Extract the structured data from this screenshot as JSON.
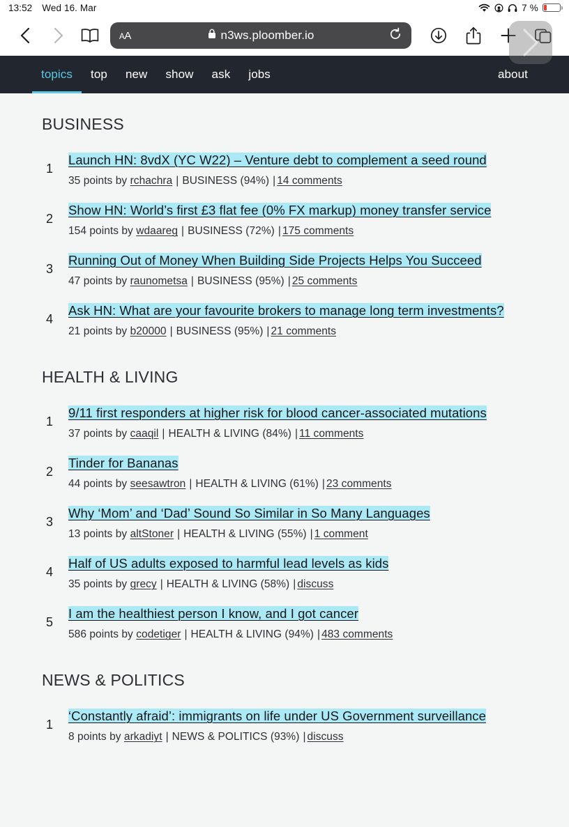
{
  "status_bar": {
    "time": "13:52",
    "date": "Wed 16. Mar",
    "battery_percent": "7 %",
    "icons": [
      "wifi-icon",
      "privacy-icon",
      "headphones-icon",
      "battery-icon"
    ]
  },
  "browser": {
    "back_label": "back-chevron",
    "forward_label": "forward-chevron",
    "bookmarks_label": "book-icon",
    "text_size_label": "AA",
    "url": "n3ws.ploomber.io",
    "reload_label": "reload-icon",
    "downloads_label": "downloads-icon",
    "share_label": "share-icon",
    "newtab_label": "plus-icon",
    "tabs_label": "tabs-icon"
  },
  "site_nav": {
    "items": [
      {
        "label": "topics",
        "active": true
      },
      {
        "label": "top",
        "active": false
      },
      {
        "label": "new",
        "active": false
      },
      {
        "label": "show",
        "active": false
      },
      {
        "label": "ask",
        "active": false
      },
      {
        "label": "jobs",
        "active": false
      }
    ],
    "about": "about",
    "accent_color": "#5bc8ea",
    "background_color": "#22262e"
  },
  "page": {
    "highlight_color": "#ace9f7",
    "background_color": "#f4f5f5",
    "sections": [
      {
        "title": "BUSINESS",
        "stories": [
          {
            "rank": "1",
            "title": "Launch HN: 8vdX (YC W22) – Venture debt to complement a seed round ",
            "points": "35 points",
            "by": "by",
            "user": "rchachra",
            "topic": "BUSINESS (94%)",
            "comments": "14 comments"
          },
          {
            "rank": "2",
            "title": "Show HN: World’s first £3 flat fee (0% FX markup) money transfer service ",
            "points": "154 points",
            "by": "by",
            "user": "wdaareg",
            "topic": "BUSINESS (72%)",
            "comments": "175 comments"
          },
          {
            "rank": "3",
            "title": "Running Out of Money When Building Side Projects Helps You Succeed ",
            "points": "47 points",
            "by": "by",
            "user": "raunometsa",
            "topic": "BUSINESS (95%)",
            "comments": "25 comments"
          },
          {
            "rank": "4",
            "title": "Ask HN: What are your favourite brokers to manage long term investments?",
            "points": "21 points",
            "by": "by",
            "user": "b20000",
            "topic": "BUSINESS (95%)",
            "comments": "21 comments"
          }
        ]
      },
      {
        "title": "HEALTH & LIVING",
        "stories": [
          {
            "rank": "1",
            "title": "9/11 first responders at higher risk for blood cancer-associated mutations ",
            "points": "37 points",
            "by": "by",
            "user": "caaqil",
            "topic": "HEALTH & LIVING (84%)",
            "comments": "11 comments"
          },
          {
            "rank": "2",
            "title": "Tinder for Bananas ",
            "points": "44 points",
            "by": "by",
            "user": "seesawtron",
            "topic": "HEALTH & LIVING (61%)",
            "comments": "23 comments"
          },
          {
            "rank": "3",
            "title": "Why ‘Mom’ and ‘Dad’ Sound So Similar in So Many Languages ",
            "points": "13 points",
            "by": "by",
            "user": "altStoner",
            "topic": "HEALTH & LIVING (55%)",
            "comments": "1 comment"
          },
          {
            "rank": "4",
            "title": "Half of US adults exposed to harmful lead levels as kids ",
            "points": "35 points",
            "by": "by",
            "user": "grecy",
            "topic": "HEALTH & LIVING (58%)",
            "comments": "discuss"
          },
          {
            "rank": "5",
            "title": "I am the healthiest person I know, and I got cancer ",
            "points": "586 points",
            "by": "by",
            "user": "codetiger",
            "topic": "HEALTH & LIVING (94%)",
            "comments": "483 comments"
          }
        ]
      },
      {
        "title": "NEWS & POLITICS",
        "stories": [
          {
            "rank": "1",
            "title": "‘Constantly afraid’: immigrants on life under US Government surveillance ",
            "points": "8 points",
            "by": "by",
            "user": "arkadiyt",
            "topic": "NEWS & POLITICS (93%)",
            "comments": "discuss"
          }
        ]
      }
    ]
  }
}
